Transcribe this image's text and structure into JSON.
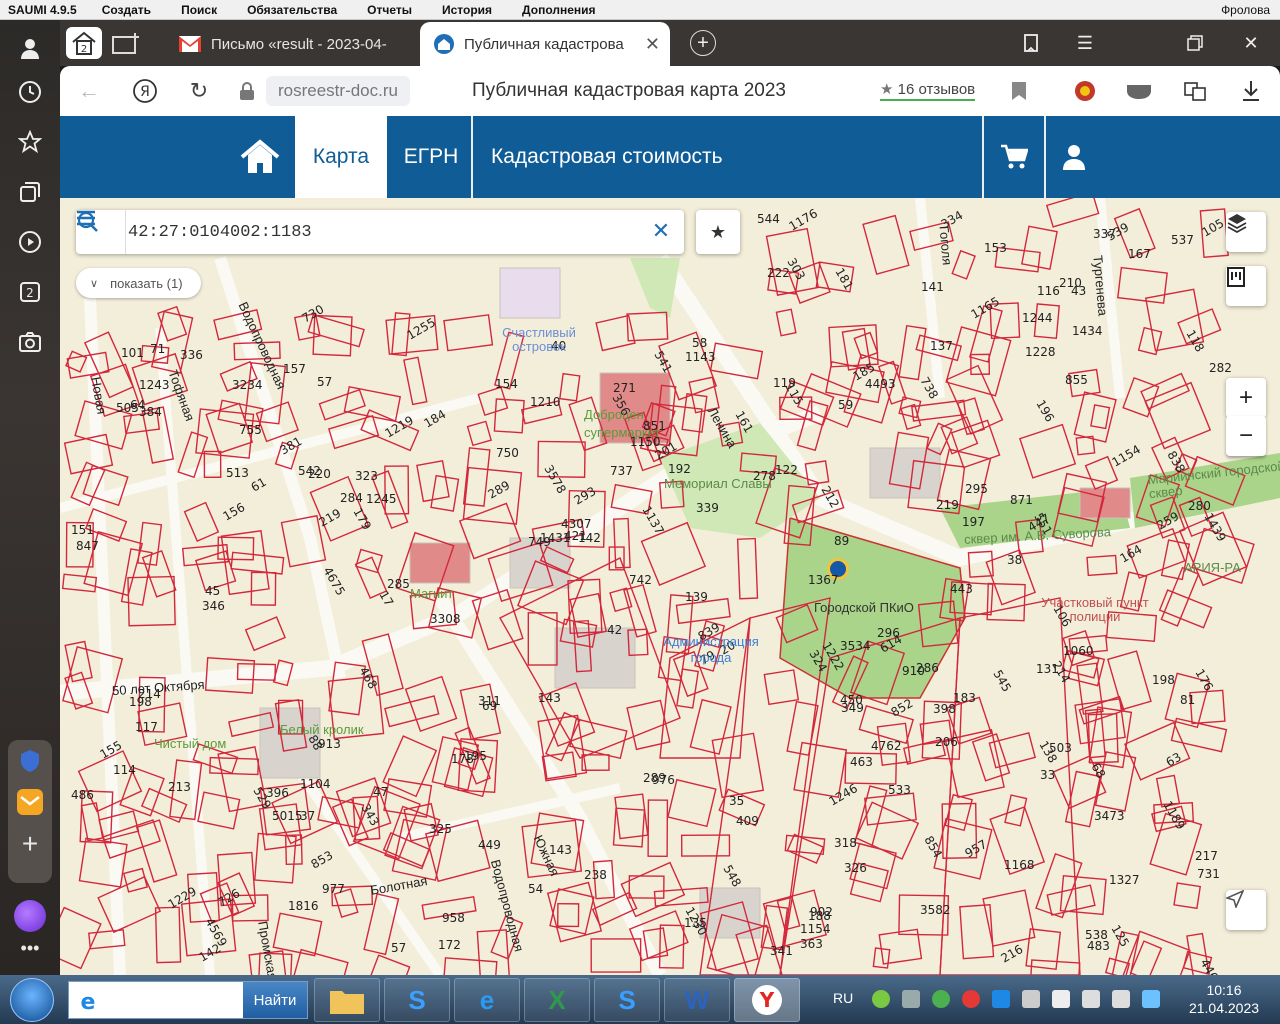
{
  "app": {
    "name": "SAUMI 4.9.5",
    "menu": [
      "Создать",
      "Поиск",
      "Обязательства",
      "Отчеты",
      "История",
      "Дополнения"
    ],
    "user": "Фролова"
  },
  "browser": {
    "tabs": {
      "home_badge": "2",
      "inactive_title": "Письмо «result - 2023-04-",
      "active_title": "Публичная кадастрова"
    },
    "url": "rosreestr-doc.ru",
    "page_title": "Публичная кадастровая карта 2023",
    "reviews": "16 отзывов"
  },
  "sidebar": {
    "badge": "2"
  },
  "site_nav": {
    "map": "Карта",
    "egrn": "ЕГРН",
    "cadastral_value": "Кадастровая стоимость"
  },
  "map": {
    "search_value": "42:27:0104002:1183",
    "show_button": "показать (1)",
    "streets": [
      "Новая",
      "Тофяная",
      "Водопроводная",
      "50 лет Октября",
      "Ленина",
      "Южная",
      "Болотная",
      "Промская",
      "Гоголя",
      "Тургенева",
      "Водопроводная"
    ],
    "pois": [
      "Счастливый островок",
      "Доброцен супермаркет",
      "Мемориал Славы",
      "Магнит",
      "Городской ПКиО",
      "Администрация города",
      "Белый кролик",
      "Чистый дом",
      "сквер им. А.В. Суворова",
      "Мариинский городской сквер",
      "АРИЯ-РА",
      "Участковый пункт полиции"
    ],
    "parcels": [
      "346",
      "157",
      "238",
      "172",
      "977",
      "976",
      "271",
      "1439",
      "3534",
      "356",
      "902",
      "4675",
      "384",
      "4569",
      "1367",
      "1165",
      "293",
      "852",
      "463",
      "851",
      "1143",
      "853",
      "854",
      "855",
      "286",
      "503",
      "1154",
      "289",
      "106",
      "349",
      "1176",
      "910",
      "913",
      "3473",
      "381",
      "1222",
      "1168",
      "1104",
      "513",
      "3578",
      "4307",
      "3582",
      "4493",
      "4762",
      "5015",
      "1230",
      "1150",
      "539",
      "1228",
      "3234",
      "69",
      "1327",
      "220",
      "89",
      "614",
      "88",
      "1137",
      "119",
      "45",
      "184",
      "81",
      "105",
      "122",
      "196",
      "195",
      "198",
      "197",
      "259",
      "1229",
      "1219",
      "1210",
      "114",
      "341",
      "339",
      "1245",
      "61",
      "334",
      "336",
      "337",
      "1244",
      "958",
      "957",
      "1255",
      "1434",
      "398",
      "57",
      "59",
      "58",
      "179",
      "178",
      "143",
      "505",
      "363",
      "115",
      "1431",
      "1189",
      "533",
      "188",
      "446",
      "311",
      "450",
      "447",
      "529",
      "216",
      "212",
      "755",
      "176",
      "742",
      "731",
      "730",
      "318",
      "483",
      "222",
      "326",
      "537",
      "538",
      "210",
      "325",
      "324",
      "295",
      "551",
      "541",
      "542",
      "544",
      "545",
      "548",
      "219",
      "486",
      "737",
      "323",
      "738",
      "449",
      "1816",
      "726",
      "468",
      "396",
      "750",
      "303",
      "749",
      "443",
      "409",
      "343",
      "131",
      "54",
      "1060",
      "181",
      "183",
      "142",
      "139",
      "185",
      "137",
      "135",
      "217",
      "201",
      "206",
      "35",
      "37",
      "101",
      "192",
      "117",
      "214",
      "198",
      "167",
      "116",
      "138",
      "285",
      "284",
      "282",
      "280",
      "278",
      "17",
      "47",
      "64",
      "57",
      "289",
      "33",
      "38",
      "296",
      "164",
      "161",
      "155",
      "421",
      "79",
      "71",
      "20",
      "838",
      "839",
      "847",
      "153",
      "154",
      "156",
      "151",
      "141",
      "142",
      "143",
      "213",
      "214",
      "219",
      "1246",
      "871",
      "125",
      "1154",
      "118",
      "63",
      "68",
      "3308",
      "40",
      "42",
      "43",
      "1243"
    ]
  },
  "taskbar": {
    "search_button": "Найти",
    "lang": "RU",
    "time": "10:16",
    "date": "21.04.2023"
  }
}
